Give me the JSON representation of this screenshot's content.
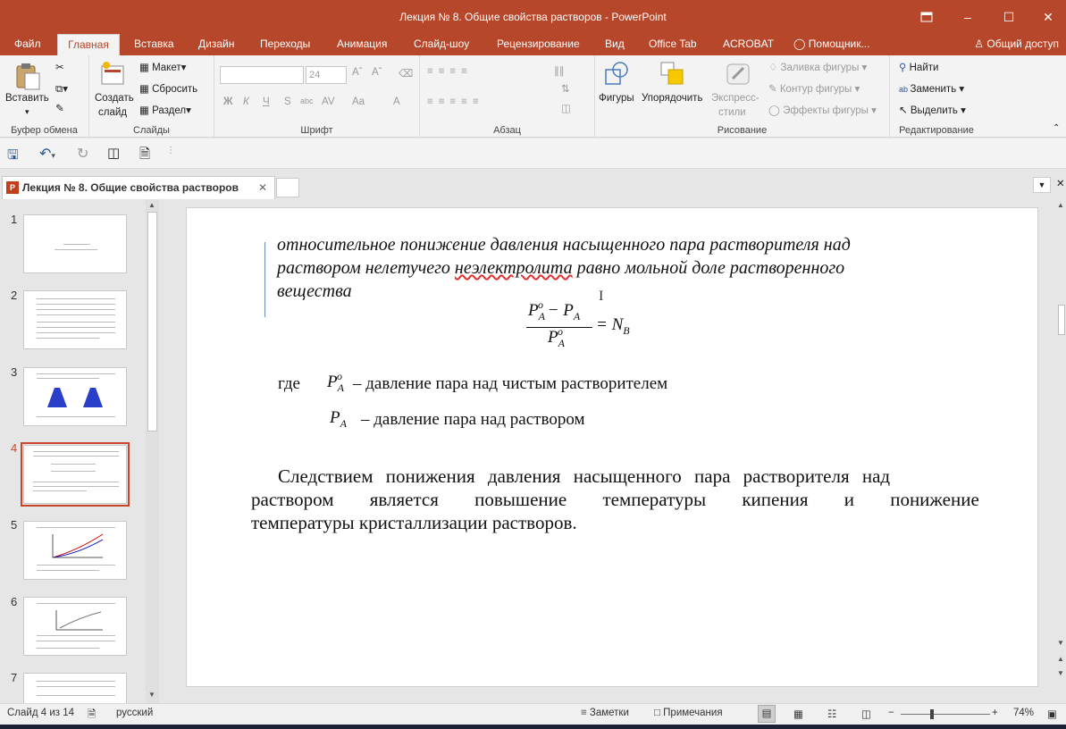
{
  "window": {
    "title": "Лекция № 8. Общие свойства растворов - PowerPoint",
    "colors": {
      "accent": "#b7472a",
      "ribbon_bg": "#f3f3f3",
      "selected_thumb": "#c8472a"
    }
  },
  "ribbon_tabs": [
    "Файл",
    "Главная",
    "Вставка",
    "Дизайн",
    "Переходы",
    "Анимация",
    "Слайд-шоу",
    "Рецензирование",
    "Вид",
    "Office Tab",
    "ACROBAT",
    "Помощник..."
  ],
  "active_tab": "Главная",
  "share_label": "Общий доступ",
  "ribbon": {
    "clipboard": {
      "paste": "Вставить",
      "label": "Буфер обмена"
    },
    "slides": {
      "create": "Создать",
      "create2": "слайд",
      "layout": "Макет",
      "reset": "Сбросить",
      "section": "Раздел",
      "label": "Слайды"
    },
    "font": {
      "size": "24",
      "bold": "Ж",
      "italic": "К",
      "underline": "Ч",
      "strike": "S",
      "shadow": "abc",
      "spacing": "AV",
      "case": "Aa",
      "color": "A",
      "label": "Шрифт"
    },
    "paragraph": {
      "label": "Абзац"
    },
    "drawing": {
      "shapes": "Фигуры",
      "arrange": "Упорядочить",
      "express": "Экспресс-",
      "express2": "стили",
      "fill": "Заливка фигуры",
      "outline": "Контур фигуры",
      "effects": "Эффекты фигуры",
      "label": "Рисование"
    },
    "editing": {
      "find": "Найти",
      "replace": "Заменить",
      "select": "Выделить",
      "label": "Редактирование"
    }
  },
  "doc_tab": "Лекция № 8. Общие свойства растворов",
  "thumbnails": [
    "1",
    "2",
    "3",
    "4",
    "5",
    "6",
    "7"
  ],
  "selected_slide": "4",
  "slide": {
    "line1": "относительное понижение давления насыщенного пара растворителя   над",
    "line2a": "раствором нелетучего ",
    "line2b": "неэлектролита",
    "line2c": " равно мольной доле растворенного",
    "line3": "вещества",
    "where": "где",
    "def1": "– давление пара над чистым растворителем",
    "def2": "– давление пара над раствором",
    "para1": "Следствием понижения давления насыщенного пара растворителя над",
    "para2": "раствором является повышение температуры кипения и понижение",
    "para3": "температуры кристаллизации растворов."
  },
  "status": {
    "slide_info": "Слайд 4 из 14",
    "language": "русский",
    "notes": "Заметки",
    "comments": "Примечания",
    "zoom": "74%"
  }
}
